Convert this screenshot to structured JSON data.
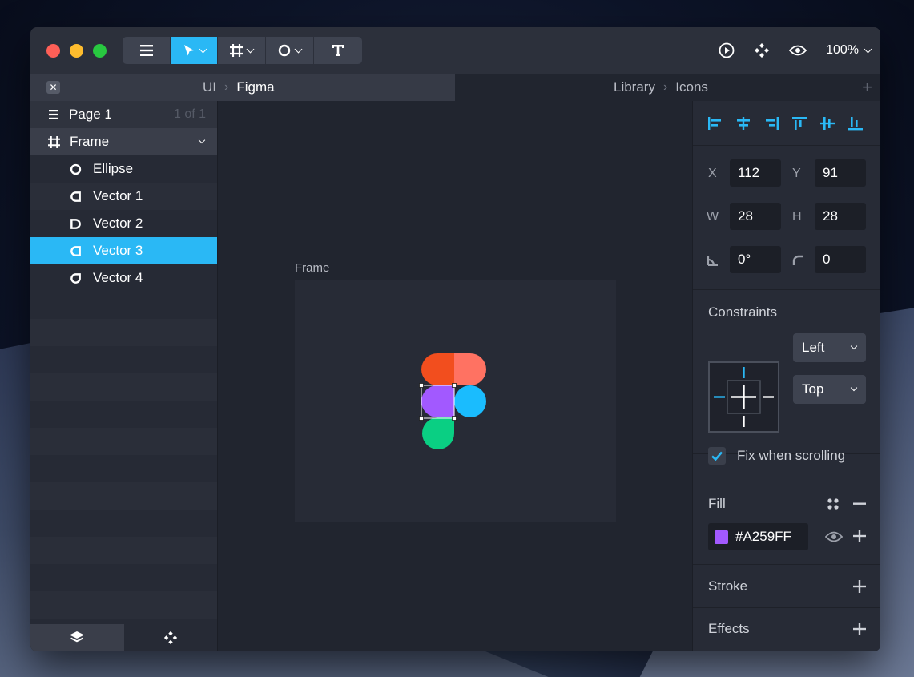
{
  "titlebar": {
    "zoom": "100%",
    "tools": [
      {
        "name": "menu-icon"
      },
      {
        "name": "move-tool-icon"
      },
      {
        "name": "frame-tool-icon"
      },
      {
        "name": "ellipse-tool-icon"
      },
      {
        "name": "text-tool-icon"
      }
    ]
  },
  "tabs": {
    "left": {
      "crumb1": "UI",
      "crumb2": "Figma"
    },
    "right": {
      "crumb1": "Library",
      "crumb2": "Icons"
    }
  },
  "layers": {
    "page_label": "Page 1",
    "page_count": "1 of 1",
    "frame_label": "Frame",
    "items": [
      {
        "label": "Ellipse"
      },
      {
        "label": "Vector 1"
      },
      {
        "label": "Vector 2"
      },
      {
        "label": "Vector 3"
      },
      {
        "label": "Vector 4"
      }
    ]
  },
  "canvas": {
    "frame_label": "Frame",
    "logo_colors": {
      "red": "#F24E1E",
      "coral": "#FF7262",
      "purple": "#A259FF",
      "blue": "#1ABCFE",
      "green": "#0ACF83"
    }
  },
  "properties": {
    "x_label": "X",
    "x_value": "112",
    "y_label": "Y",
    "y_value": "91",
    "w_label": "W",
    "w_value": "28",
    "h_label": "H",
    "h_value": "28",
    "rotation_value": "0°",
    "radius_value": "0"
  },
  "constraints": {
    "title": "Constraints",
    "horizontal": "Left",
    "vertical": "Top",
    "fix_label": "Fix when scrolling"
  },
  "fill": {
    "title": "Fill",
    "hex": "#A259FF",
    "color": "#A259FF"
  },
  "stroke": {
    "title": "Stroke"
  },
  "effects": {
    "title": "Effects"
  },
  "theme": {
    "accent": "#2AB8F5"
  }
}
